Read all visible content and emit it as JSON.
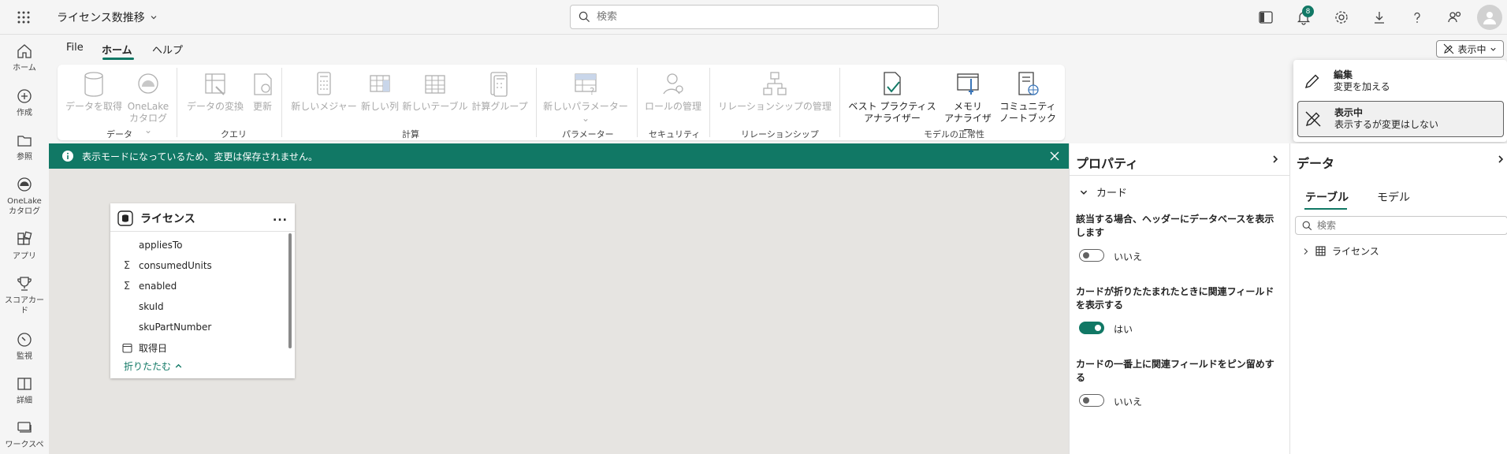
{
  "topbar": {
    "app_title": "ライセンス数推移",
    "search_placeholder": "検索",
    "notification_count": "8"
  },
  "leftnav": {
    "items": [
      {
        "label": "ホーム"
      },
      {
        "label": "作成"
      },
      {
        "label": "参照"
      },
      {
        "label": "OneLake カタログ"
      },
      {
        "label": "アプリ"
      },
      {
        "label": "スコアカード"
      },
      {
        "label": "監視"
      },
      {
        "label": "詳細"
      },
      {
        "label": "ワークスペ"
      }
    ]
  },
  "ribbon": {
    "tabs": {
      "file": "File",
      "home": "ホーム",
      "help": "ヘルプ"
    },
    "buttons": {
      "get_data": "データを取得",
      "onelake_1": "OneLake",
      "onelake_2": "カタログ",
      "transform": "データの変換",
      "refresh": "更新",
      "new_measure": "新しいメジャー",
      "new_column": "新しい列",
      "new_table": "新しいテーブル",
      "calc_group": "計算グループ",
      "new_param": "新しいパラメーター",
      "manage_roles": "ロールの管理",
      "manage_rel": "リレーションシップの管理",
      "bpa_1": "ベスト プラクティス",
      "bpa_2": "アナライザー",
      "mem_1": "メモリ",
      "mem_2": "アナライザー",
      "nb_1": "コミュニティ",
      "nb_2": "ノートブック"
    },
    "groups": {
      "data": "データ",
      "query": "クエリ",
      "calc": "計算",
      "params": "パラメーター",
      "security": "セキュリティ",
      "relationships": "リレーションシップ",
      "model_health": "モデルの正常性"
    }
  },
  "mode": {
    "button_label": "表示中",
    "menu": {
      "edit_title": "編集",
      "edit_desc": "変更を加える",
      "view_title": "表示中",
      "view_desc": "表示するが変更はしない"
    }
  },
  "banner": {
    "text": "表示モードになっているため、変更は保存されません。"
  },
  "card": {
    "title": "ライセンス",
    "more": "...",
    "fields": [
      {
        "name": "appliesTo",
        "icon": ""
      },
      {
        "name": "consumedUnits",
        "icon": "Σ"
      },
      {
        "name": "enabled",
        "icon": "Σ"
      },
      {
        "name": "skuId",
        "icon": ""
      },
      {
        "name": "skuPartNumber",
        "icon": ""
      },
      {
        "name": "取得日",
        "icon": "calendar"
      }
    ],
    "collapse_label": "折りたたむ"
  },
  "properties": {
    "title": "プロパティ",
    "section": "カード",
    "items": [
      {
        "label": "該当する場合、ヘッダーにデータベースを表示します",
        "value": "いいえ",
        "on": false
      },
      {
        "label": "カードが折りたたまれたときに関連フィールドを表示する",
        "value": "はい",
        "on": true
      },
      {
        "label": "カードの一番上に関連フィールドをピン留めする",
        "value": "いいえ",
        "on": false
      }
    ]
  },
  "data_pane": {
    "title": "データ",
    "tabs": {
      "tables": "テーブル",
      "model": "モデル"
    },
    "search_placeholder": "検索",
    "tree_item": "ライセンス"
  },
  "colors": {
    "accent": "#117865",
    "canvas": "#e6e4e1",
    "chrome": "#f5f5f5"
  }
}
